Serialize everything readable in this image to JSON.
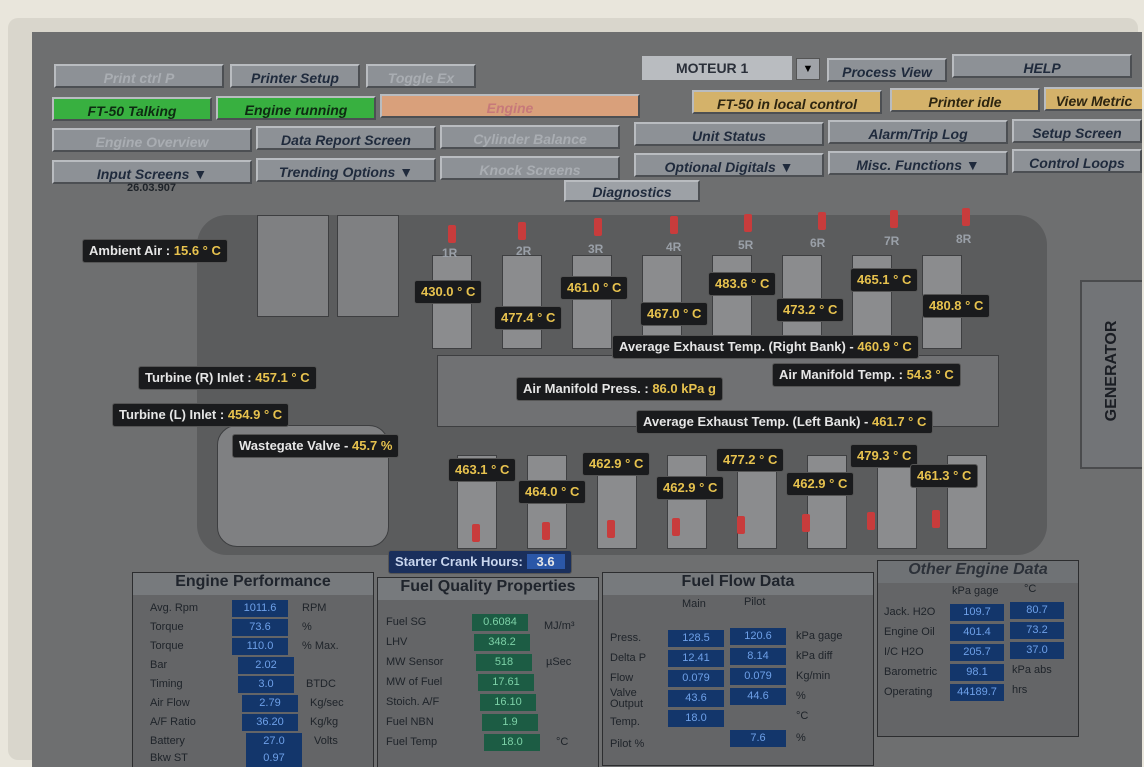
{
  "toolbar": {
    "row1": [
      "Print ctrl P",
      "Printer Setup",
      "Toggle Ex",
      "MOTEUR 1",
      "Process View",
      "HELP"
    ],
    "row2": [
      "FT-50 Talking",
      "Engine running",
      "Engine",
      "FT-50 in local control",
      "Printer idle",
      "View Metric"
    ],
    "row3": [
      "Engine Overview",
      "Data Report Screen",
      "Cylinder Balance",
      "Unit Status",
      "Alarm/Trip Log",
      "Setup Screen"
    ],
    "row4": [
      "Input Screens",
      "Trending Options",
      "Knock Screens",
      "Optional Digitals",
      "Misc. Functions",
      "Control Loops"
    ],
    "diagnostics": "Diagnostics",
    "date_stamp": "26.03.907"
  },
  "engine": {
    "cylinder_labels": [
      "1R",
      "2R",
      "3R",
      "4R",
      "5R",
      "6R",
      "7R",
      "8R"
    ],
    "right_bank_temps": [
      "430.0 ° C",
      "477.4 ° C",
      "461.0 ° C",
      "467.0 ° C",
      "483.6 ° C",
      "473.2 ° C",
      "465.1 ° C",
      "480.8 ° C"
    ],
    "left_bank_temps": [
      "463.1 ° C",
      "464.0 ° C",
      "462.9 ° C",
      "462.9 ° C",
      "477.2 ° C",
      "462.9 ° C",
      "479.3 ° C",
      "461.3 ° C"
    ],
    "ambient_label": "Ambient Air :",
    "ambient_value": "15.6 ° C",
    "turbine_r_label": "Turbine (R) Inlet :",
    "turbine_r_value": "457.1 ° C",
    "turbine_l_label": "Turbine (L) Inlet :",
    "turbine_l_value": "454.9 ° C",
    "wastegate_label": "Wastegate Valve -",
    "wastegate_value": "45.7 %",
    "avg_right_label": "Average Exhaust Temp. (Right Bank) -",
    "avg_right_value": "460.9 ° C",
    "avg_left_label": "Average Exhaust Temp. (Left Bank) -",
    "avg_left_value": "461.7 ° C",
    "air_press_label": "Air Manifold Press. :",
    "air_press_value": "86.0 kPa g",
    "air_temp_label": "Air Manifold Temp. :",
    "air_temp_value": "54.3 ° C",
    "generator": "GENERATOR"
  },
  "starter": {
    "label": "Starter Crank Hours:",
    "value": "3.6"
  },
  "engine_performance": {
    "title": "Engine Performance",
    "rows": [
      {
        "label": "Avg. Rpm",
        "value": "1011.6",
        "unit": "RPM"
      },
      {
        "label": "Torque",
        "value": "73.6",
        "unit": "%"
      },
      {
        "label": "Torque",
        "value": "110.0",
        "unit": "% Max."
      },
      {
        "label": "Bar",
        "value": "2.02",
        "unit": ""
      },
      {
        "label": "Timing",
        "value": "3.0",
        "unit": "BTDC"
      },
      {
        "label": "Air Flow",
        "value": "2.79",
        "unit": "Kg/sec"
      },
      {
        "label": "A/F Ratio",
        "value": "36.20",
        "unit": "Kg/kg"
      },
      {
        "label": "Battery",
        "value": "27.0",
        "unit": "Volts"
      },
      {
        "label": "Bkw ST",
        "value": "0.97",
        "unit": ""
      }
    ]
  },
  "fuel_quality": {
    "title": "Fuel Quality Properties",
    "rows": [
      {
        "label": "Fuel SG",
        "value": "0.6084",
        "unit": "MJ/m³"
      },
      {
        "label": "LHV",
        "value": "348.2",
        "unit": ""
      },
      {
        "label": "MW Sensor",
        "value": "518",
        "unit": "µSec"
      },
      {
        "label": "MW of Fuel",
        "value": "17.61",
        "unit": ""
      },
      {
        "label": "Stoich. A/F",
        "value": "16.10",
        "unit": ""
      },
      {
        "label": "Fuel NBN",
        "value": "1.9",
        "unit": ""
      },
      {
        "label": "Fuel Temp",
        "value": "18.0",
        "unit": "°C"
      }
    ]
  },
  "fuel_flow": {
    "title": "Fuel Flow Data",
    "col_main": "Main",
    "col_pilot": "Pilot",
    "rows": [
      {
        "label": "Press.",
        "main": "128.5",
        "pilot": "120.6",
        "unit": "kPa gage"
      },
      {
        "label": "Delta P",
        "main": "12.41",
        "pilot": "8.14",
        "unit": "kPa diff"
      },
      {
        "label": "Flow",
        "main": "0.079",
        "pilot": "0.079",
        "unit": "Kg/min"
      },
      {
        "label": "Valve Output",
        "main": "43.6",
        "pilot": "44.6",
        "unit": "%"
      },
      {
        "label": "Temp.",
        "main": "18.0",
        "pilot": "",
        "unit": "°C"
      },
      {
        "label": "Pilot %",
        "main": "",
        "pilot": "7.6",
        "unit": "%"
      }
    ]
  },
  "other_engine": {
    "title": "Other Engine Data",
    "col1": "kPa gage",
    "col2": "°C",
    "rows": [
      {
        "label": "Jack. H2O",
        "v1": "109.7",
        "v2": "80.7"
      },
      {
        "label": "Engine Oil",
        "v1": "401.4",
        "v2": "73.2"
      },
      {
        "label": "I/C H2O",
        "v1": "205.7",
        "v2": "37.0"
      },
      {
        "label": "Barometric",
        "v1": "98.1",
        "v2": "kPa abs"
      },
      {
        "label": "Operating",
        "v1": "44189.7",
        "v2": "hrs"
      }
    ]
  }
}
